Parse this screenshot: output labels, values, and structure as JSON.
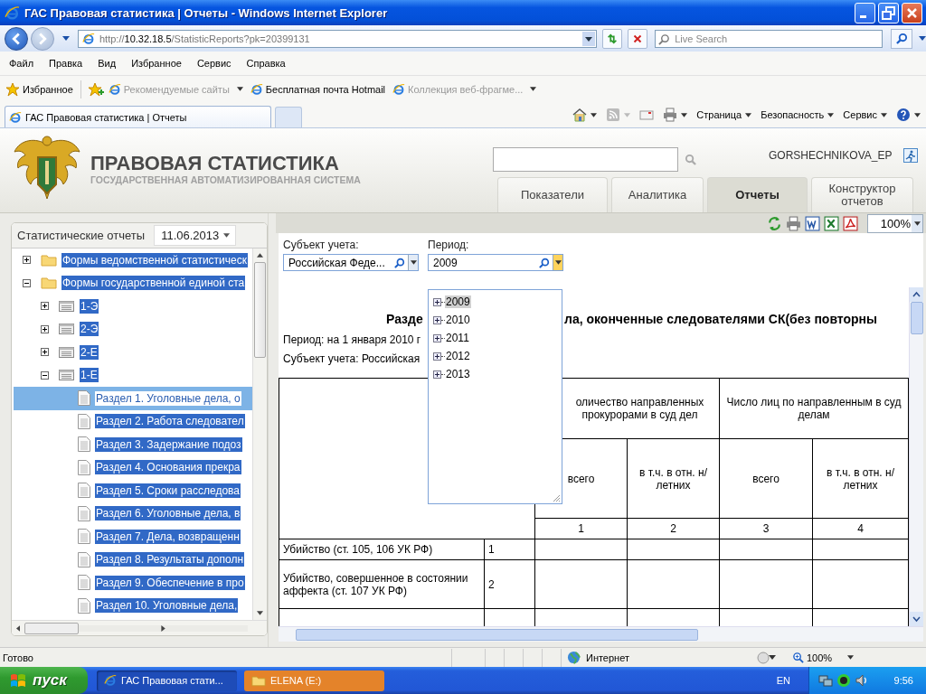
{
  "window": {
    "title": "ГАС Правовая статистика | Отчеты - Windows Internet Explorer"
  },
  "address_bar": {
    "url_scheme": "http://",
    "url_host": "10.32.18.5",
    "url_path": "/StatisticReports?pk=20399131",
    "search_placeholder": "Live Search"
  },
  "menu": [
    "Файл",
    "Правка",
    "Вид",
    "Избранное",
    "Сервис",
    "Справка"
  ],
  "favorites_bar": {
    "favorites": "Избранное",
    "links": [
      {
        "label": "Рекомендуемые сайты",
        "dropdown": true,
        "disabled": true
      },
      {
        "label": "Бесплатная почта Hotmail",
        "dropdown": false,
        "disabled": false
      },
      {
        "label": "Коллекция веб-фрагме...",
        "dropdown": true,
        "disabled": true
      }
    ]
  },
  "browser_tabs": [
    {
      "label": "ГАС Правовая статистика | Отчеты",
      "selected": true
    }
  ],
  "command_bar": [
    "Страница",
    "Безопасность",
    "Сервис"
  ],
  "site_header": {
    "title": "ПРАВОВАЯ СТАТИСТИКА",
    "subtitle": "ГОСУДАРСТВЕННАЯ АВТОМАТИЗИРОВАННАЯ СИСТЕМА",
    "user": "GORSHECHNIKOVA_EP"
  },
  "nav_tabs": [
    {
      "label": "Показатели",
      "selected": false
    },
    {
      "label": "Аналитика",
      "selected": false
    },
    {
      "label": "Отчеты",
      "selected": true
    },
    {
      "label": "Конструктор отчетов",
      "selected": false
    }
  ],
  "reports_panel": {
    "title": "Статистические отчеты",
    "date": "11.06.2013",
    "tree": [
      {
        "label": "Формы ведомственной статистическ",
        "kind": "folder",
        "expanded": false
      },
      {
        "label": "Формы государственной единой ста",
        "kind": "folder",
        "expanded": true,
        "children": [
          {
            "label": "1-Э",
            "kind": "form",
            "expanded": false
          },
          {
            "label": "2-Э",
            "kind": "form",
            "expanded": false
          },
          {
            "label": "2-Е",
            "kind": "form",
            "expanded": false
          },
          {
            "label": "1-Е",
            "kind": "form",
            "expanded": true,
            "children": [
              {
                "label": "Раздел 1. Уголовные дела, о",
                "kind": "section",
                "selected": true
              },
              {
                "label": "Раздел 2. Работа следовател",
                "kind": "section",
                "selected": false
              },
              {
                "label": "Раздел 3. Задержание подоз",
                "kind": "section",
                "selected": false
              },
              {
                "label": "Раздел 4. Основания прекра",
                "kind": "section",
                "selected": false
              },
              {
                "label": "Раздел 5. Сроки расследова",
                "kind": "section",
                "selected": false
              },
              {
                "label": "Раздел 6. Уголовные дела, в",
                "kind": "section",
                "selected": false
              },
              {
                "label": "Раздел 7. Дела, возвращенн",
                "kind": "section",
                "selected": false
              },
              {
                "label": "Раздел 8. Результаты дополн",
                "kind": "section",
                "selected": false
              },
              {
                "label": "Раздел 9. Обеспечение в про",
                "kind": "section",
                "selected": false
              },
              {
                "label": "Раздел 10. Уголовные дела,",
                "kind": "section",
                "selected": false
              }
            ]
          }
        ]
      }
    ]
  },
  "toolbar": {
    "zoom": "100%"
  },
  "filters": [
    {
      "label": "Субъект учета:",
      "value": "Российская Феде...",
      "open": false
    },
    {
      "label": "Период:",
      "value": "2009",
      "open": true,
      "options": [
        {
          "label": "2009",
          "selected": true
        },
        {
          "label": "2010",
          "selected": false
        },
        {
          "label": "2011",
          "selected": false
        },
        {
          "label": "2012",
          "selected": false
        },
        {
          "label": "2013",
          "selected": false
        }
      ]
    }
  ],
  "report": {
    "title_parts": [
      "Разде",
      "ла, оконченные следователями СК(без повторны"
    ],
    "period": "Период: на 1 января 2010 г",
    "subject": "Субъект учета: Российская",
    "table": {
      "groups": [
        "оличество направленных прокурорами в суд дел",
        "Число лиц по направленным в суд делам"
      ],
      "subheaders": [
        "всего",
        "в т.ч. в отн. н/летних",
        "всего",
        "в т.ч. в отн. н/летних"
      ],
      "column_numbers": [
        "1",
        "2",
        "3",
        "4"
      ],
      "rows": [
        {
          "label": "Убийство (ст. 105, 106 УК РФ)",
          "number": "1"
        },
        {
          "label": "Убийство, совершенное в состоянии аффекта (ст. 107 УК РФ)",
          "number": "2"
        }
      ]
    }
  },
  "status_bar": {
    "text": "Готово",
    "zone": "Интернет",
    "zoom": "100%"
  },
  "taskbar": {
    "start": "пуск",
    "tasks": [
      {
        "label": "ГАС Правовая стати...",
        "kind": "browser",
        "selected": true
      },
      {
        "label": "ELENA (E:)",
        "kind": "folder",
        "selected": false
      }
    ],
    "language": "EN",
    "clock": "9:56"
  }
}
